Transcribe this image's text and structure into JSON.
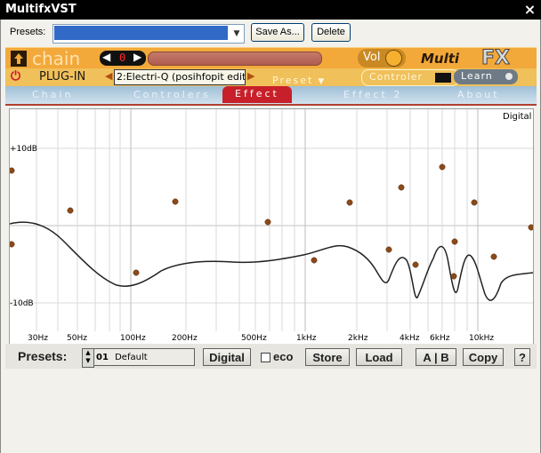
{
  "window": {
    "title": "MultifxVST",
    "close_glyph": "×"
  },
  "presets_bar": {
    "label": "Presets:",
    "save_as": "Save As...",
    "delete": "Delete"
  },
  "header": {
    "chain_label": "chain",
    "counter_value": "0",
    "vol_label": "Vol",
    "logo_left": "Multi",
    "logo_right": "FX",
    "plugin_label": "PLUG-IN",
    "plugin_name": "2:Electri-Q (posihfopit editi...",
    "preset_label": "Preset",
    "controler_label": "Controler",
    "learn_label": "Learn"
  },
  "tabs": [
    {
      "label": "Chain"
    },
    {
      "label": "Controlers"
    },
    {
      "label": "Effect"
    },
    {
      "label": "Effect 2"
    },
    {
      "label": "About"
    }
  ],
  "active_tab": "Effect",
  "graph": {
    "mode_label": "Digital",
    "db_labels": {
      "top": "+10dB",
      "bottom": "-10dB"
    },
    "freq_labels": [
      "30Hz",
      "50Hz",
      "100Hz",
      "200Hz",
      "500Hz",
      "1kHz",
      "2kHz",
      "4kHz",
      "6kHz",
      "10kHz"
    ]
  },
  "bottom": {
    "presets_label": "Presets:",
    "preset_number": "01",
    "preset_name": "Default",
    "digital": "Digital",
    "eco": "eco",
    "store": "Store",
    "load": "Load",
    "ab": "A | B",
    "copy": "Copy",
    "help": "?"
  },
  "colors": {
    "accent_orange": "#f3a93a",
    "tab_active": "#c8202a",
    "handle": "#8a4a1a",
    "selection_blue": "#3169c6"
  }
}
